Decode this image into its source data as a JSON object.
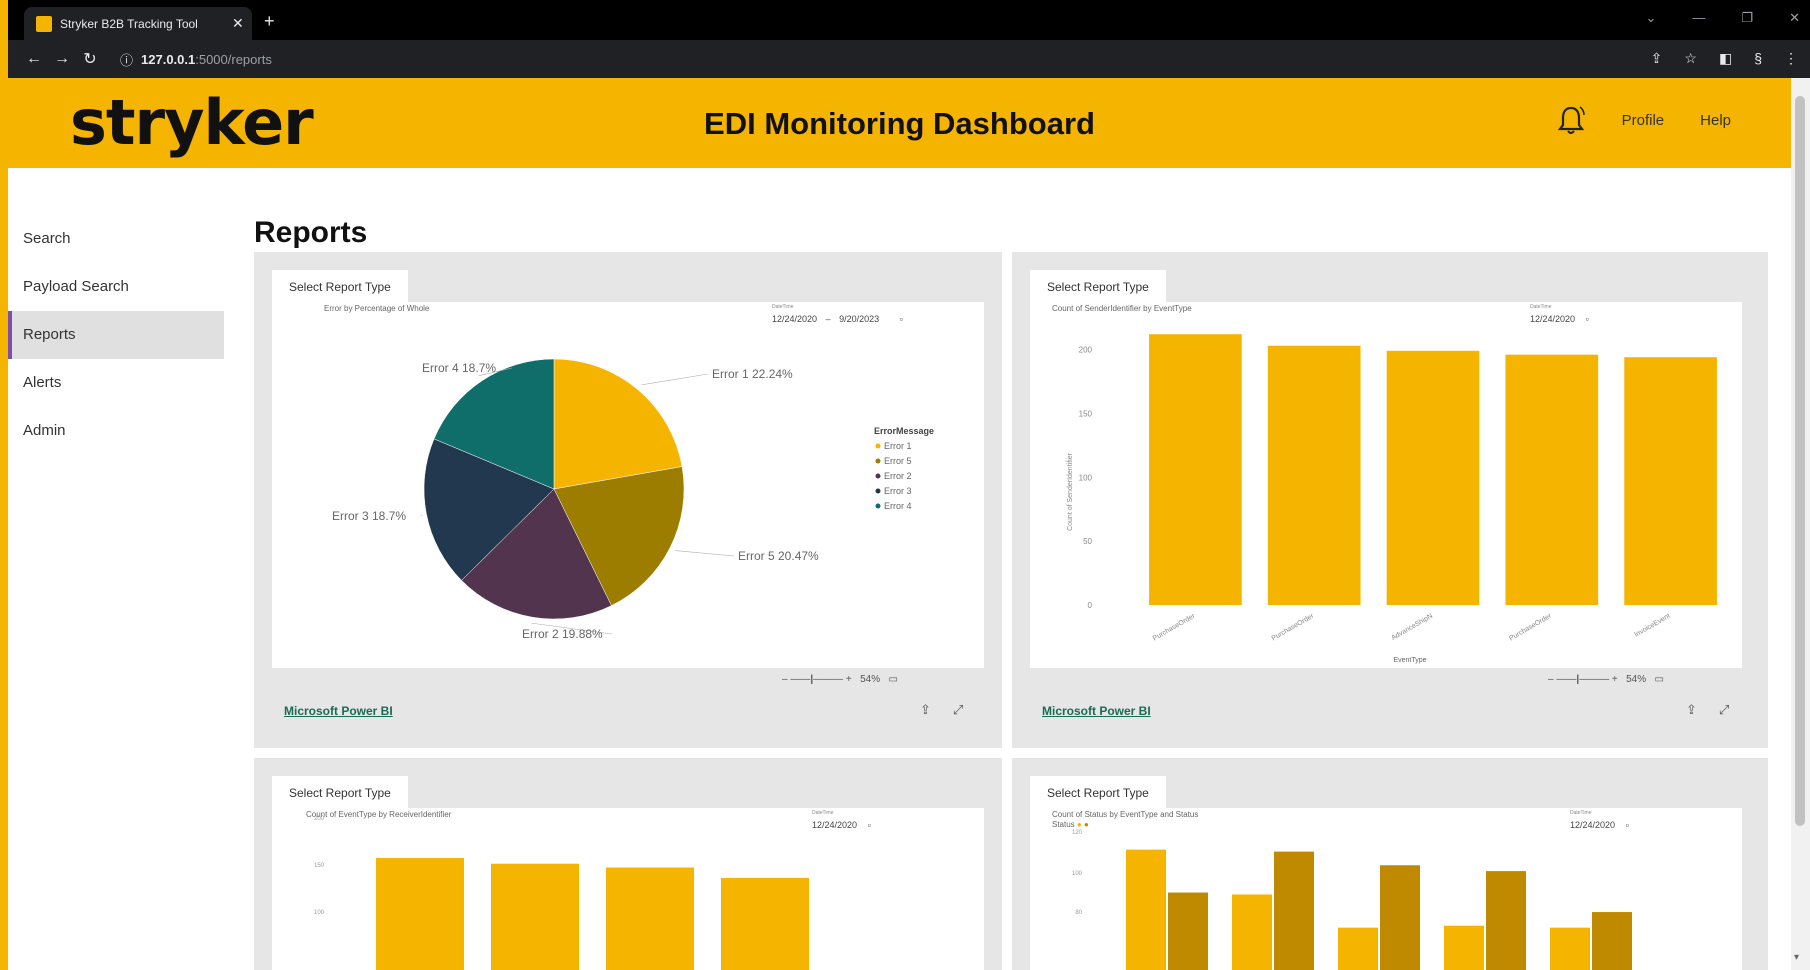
{
  "browser": {
    "tab_title": "Stryker B2B Tracking Tool",
    "url_host": "127.0.0.1",
    "url_path": ":5000/reports"
  },
  "header": {
    "logo": "stryker",
    "title": "EDI Monitoring Dashboard",
    "profile": "Profile",
    "help": "Help"
  },
  "sidebar": {
    "items": [
      {
        "label": "Search"
      },
      {
        "label": "Payload Search"
      },
      {
        "label": "Reports"
      },
      {
        "label": "Alerts"
      },
      {
        "label": "Admin"
      }
    ]
  },
  "page": {
    "title": "Reports"
  },
  "reports": [
    {
      "tab": "Select Report Type",
      "viz_title": "Error by Percentage of Whole",
      "slicer_label": "DateTime",
      "slicer_from": "12/24/2020",
      "slicer_to": "9/20/2023",
      "zoom": "54%",
      "link": "Microsoft Power BI"
    },
    {
      "tab": "Select Report Type",
      "viz_title": "Count of SenderIdentifier by EventType",
      "slicer_label": "DateTime",
      "slicer_from": "12/24/2020",
      "zoom": "54%",
      "link": "Microsoft Power BI"
    },
    {
      "tab": "Select Report Type",
      "viz_title": "Count of EventType by ReceiverIdentifier",
      "slicer_label": "DateTime",
      "slicer_from": "12/24/2020"
    },
    {
      "tab": "Select Report Type",
      "viz_title": "Count of Status by EventType and Status",
      "slicer_label": "DateTime",
      "slicer_from": "12/24/2020",
      "legend_label": "Status"
    }
  ],
  "colors": {
    "brand": "#f5b400",
    "pie": [
      "#f5b400",
      "#9c7d00",
      "#52344f",
      "#22384f",
      "#0f6e6a"
    ],
    "bar_dark": "#c08a00"
  },
  "chart_data": [
    {
      "type": "pie",
      "title": "Error by Percentage of Whole",
      "legend_title": "ErrorMessage",
      "legend": [
        "Error 1",
        "Error 5",
        "Error 2",
        "Error 3",
        "Error 4"
      ],
      "slices": [
        {
          "name": "Error 1",
          "value": 22.24,
          "label": "Error 1 22.24%"
        },
        {
          "name": "Error 5",
          "value": 20.47,
          "label": "Error 5 20.47%"
        },
        {
          "name": "Error 2",
          "value": 19.88,
          "label": "Error 2 19.88%"
        },
        {
          "name": "Error 3",
          "value": 18.7,
          "label": "Error 3 18.7%"
        },
        {
          "name": "Error 4",
          "value": 18.7,
          "label": "Error 4 18.7%"
        }
      ]
    },
    {
      "type": "bar",
      "title": "Count of SenderIdentifier by EventType",
      "xlabel": "EventType",
      "ylabel": "Count of SenderIdentifier",
      "categories": [
        "PurchaseOrder",
        "PurchaseOrder",
        "AdvanceShipN",
        "PurchaseOrder",
        "InvoiceEvent"
      ],
      "values": [
        212,
        203,
        199,
        196,
        194
      ],
      "yticks": [
        0,
        50,
        100,
        150,
        200
      ],
      "ylim": [
        0,
        220
      ]
    },
    {
      "type": "bar",
      "title": "Count of EventType by ReceiverIdentifier",
      "values": [
        110,
        104,
        100,
        89
      ],
      "yticks": [
        100,
        150,
        200
      ],
      "ylim": [
        0,
        200
      ]
    },
    {
      "type": "bar",
      "title": "Count of Status by EventType and Status",
      "series": [
        {
          "values": [
            113,
            90,
            73,
            74,
            73
          ]
        },
        {
          "values": [
            91,
            112,
            105,
            102,
            81
          ]
        }
      ],
      "yticks": [
        80,
        100,
        120
      ]
    }
  ]
}
